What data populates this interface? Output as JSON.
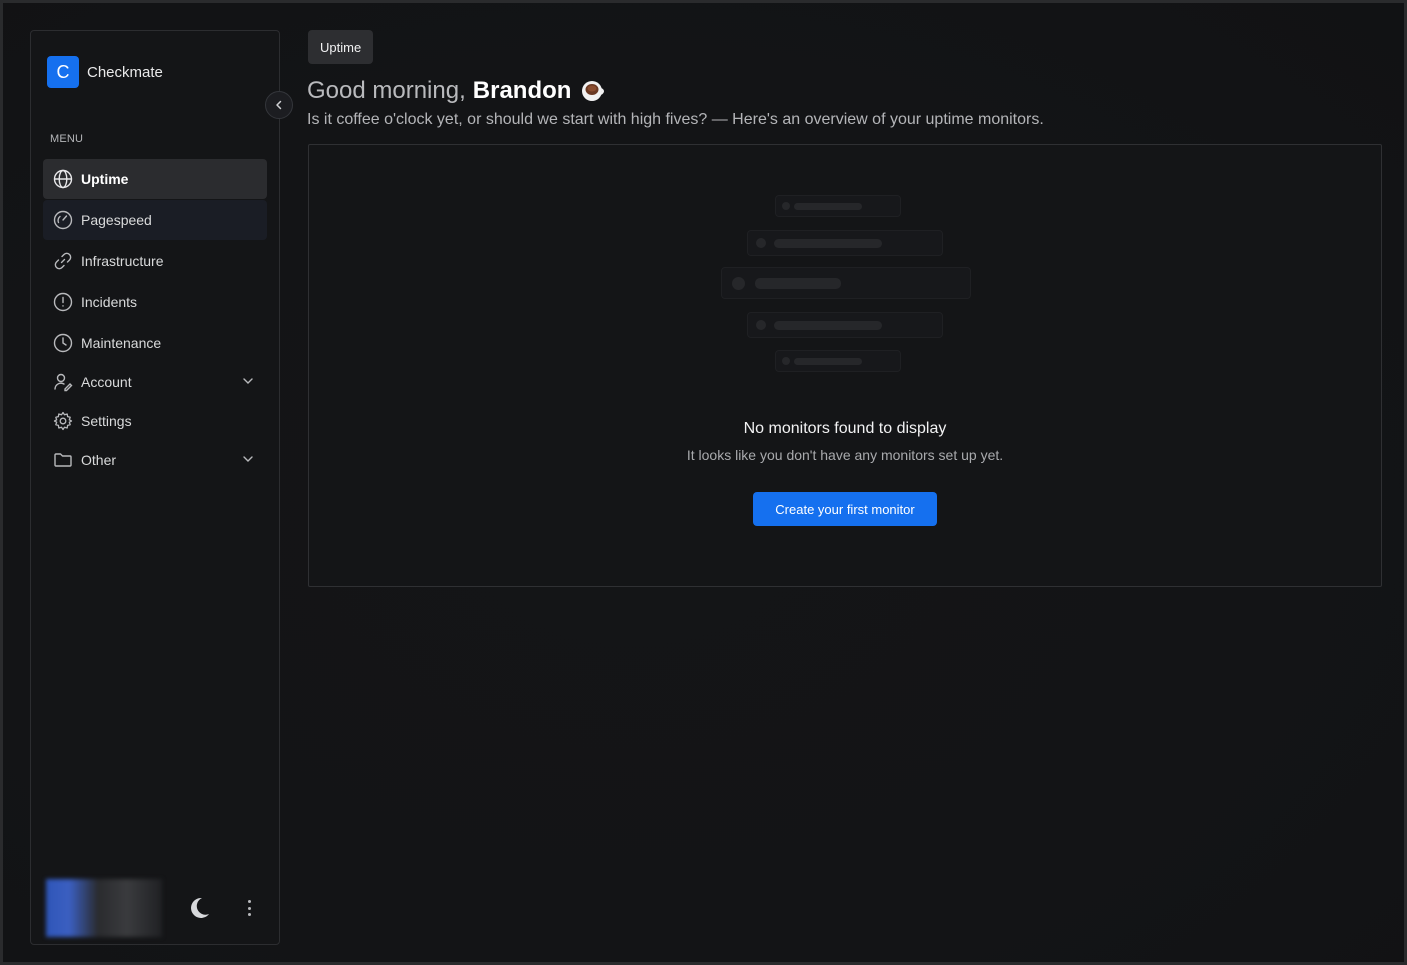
{
  "app": {
    "logo_letter": "C",
    "name": "Checkmate"
  },
  "sidebar": {
    "menu_title": "MENU",
    "items": [
      {
        "label": "Uptime",
        "icon": "globe-icon"
      },
      {
        "label": "Pagespeed",
        "icon": "gauge-icon"
      },
      {
        "label": "Infrastructure",
        "icon": "link-icon"
      },
      {
        "label": "Incidents",
        "icon": "alert-circle-icon"
      },
      {
        "label": "Maintenance",
        "icon": "clock-icon"
      },
      {
        "label": "Account",
        "icon": "user-edit-icon"
      },
      {
        "label": "Settings",
        "icon": "gear-icon"
      },
      {
        "label": "Other",
        "icon": "folder-icon"
      }
    ]
  },
  "breadcrumb": "Uptime",
  "header": {
    "greeting": "Good morning,",
    "user_name": "Brandon",
    "subtitle": "Is it coffee o'clock yet, or should we start with high fives? — Here's an overview of your uptime monitors."
  },
  "empty_state": {
    "title": "No monitors found to display",
    "description": "It looks like you don't have any monitors set up yet.",
    "cta_label": "Create your first monitor"
  },
  "colors": {
    "accent": "#1570ef",
    "background": "#151618"
  }
}
